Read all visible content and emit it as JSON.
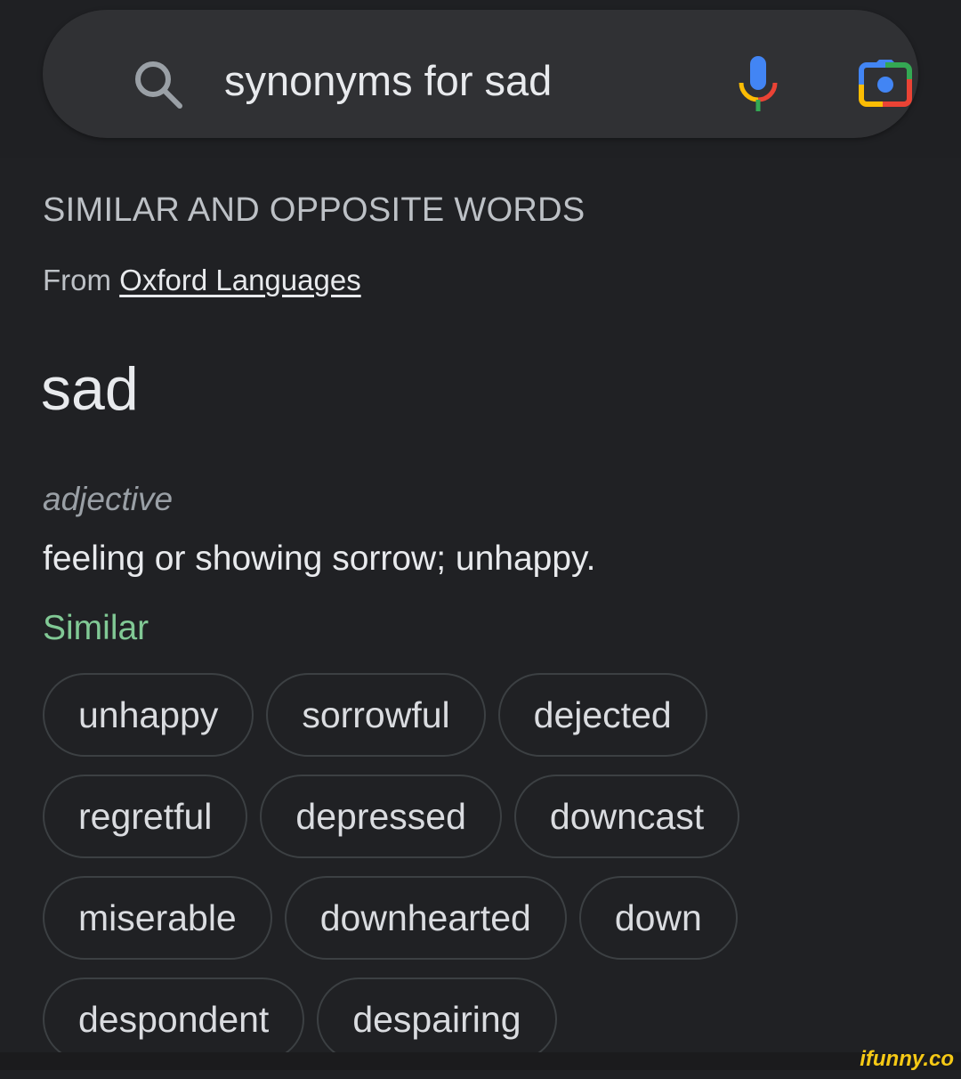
{
  "search": {
    "query": "synonyms for sad",
    "icons": [
      "search-icon",
      "microphone-icon",
      "camera-lens-icon"
    ]
  },
  "section": {
    "heading": "SIMILAR AND OPPOSITE WORDS",
    "from_label": "From",
    "source_link": "Oxford Languages"
  },
  "entry": {
    "word": "sad",
    "part_of_speech": "adjective",
    "definition": "feeling or showing sorrow; unhappy.",
    "similar_label": "Similar"
  },
  "similar_rows": [
    [
      "unhappy",
      "sorrowful",
      "dejected"
    ],
    [
      "regretful",
      "depressed",
      "downcast"
    ],
    [
      "miserable",
      "downhearted",
      "down"
    ],
    [
      "despondent",
      "despairing"
    ]
  ],
  "watermark": "ifunny.co",
  "colors": {
    "background": "#202124",
    "similar_label": "#81c995",
    "chip_border": "#3c4043"
  }
}
